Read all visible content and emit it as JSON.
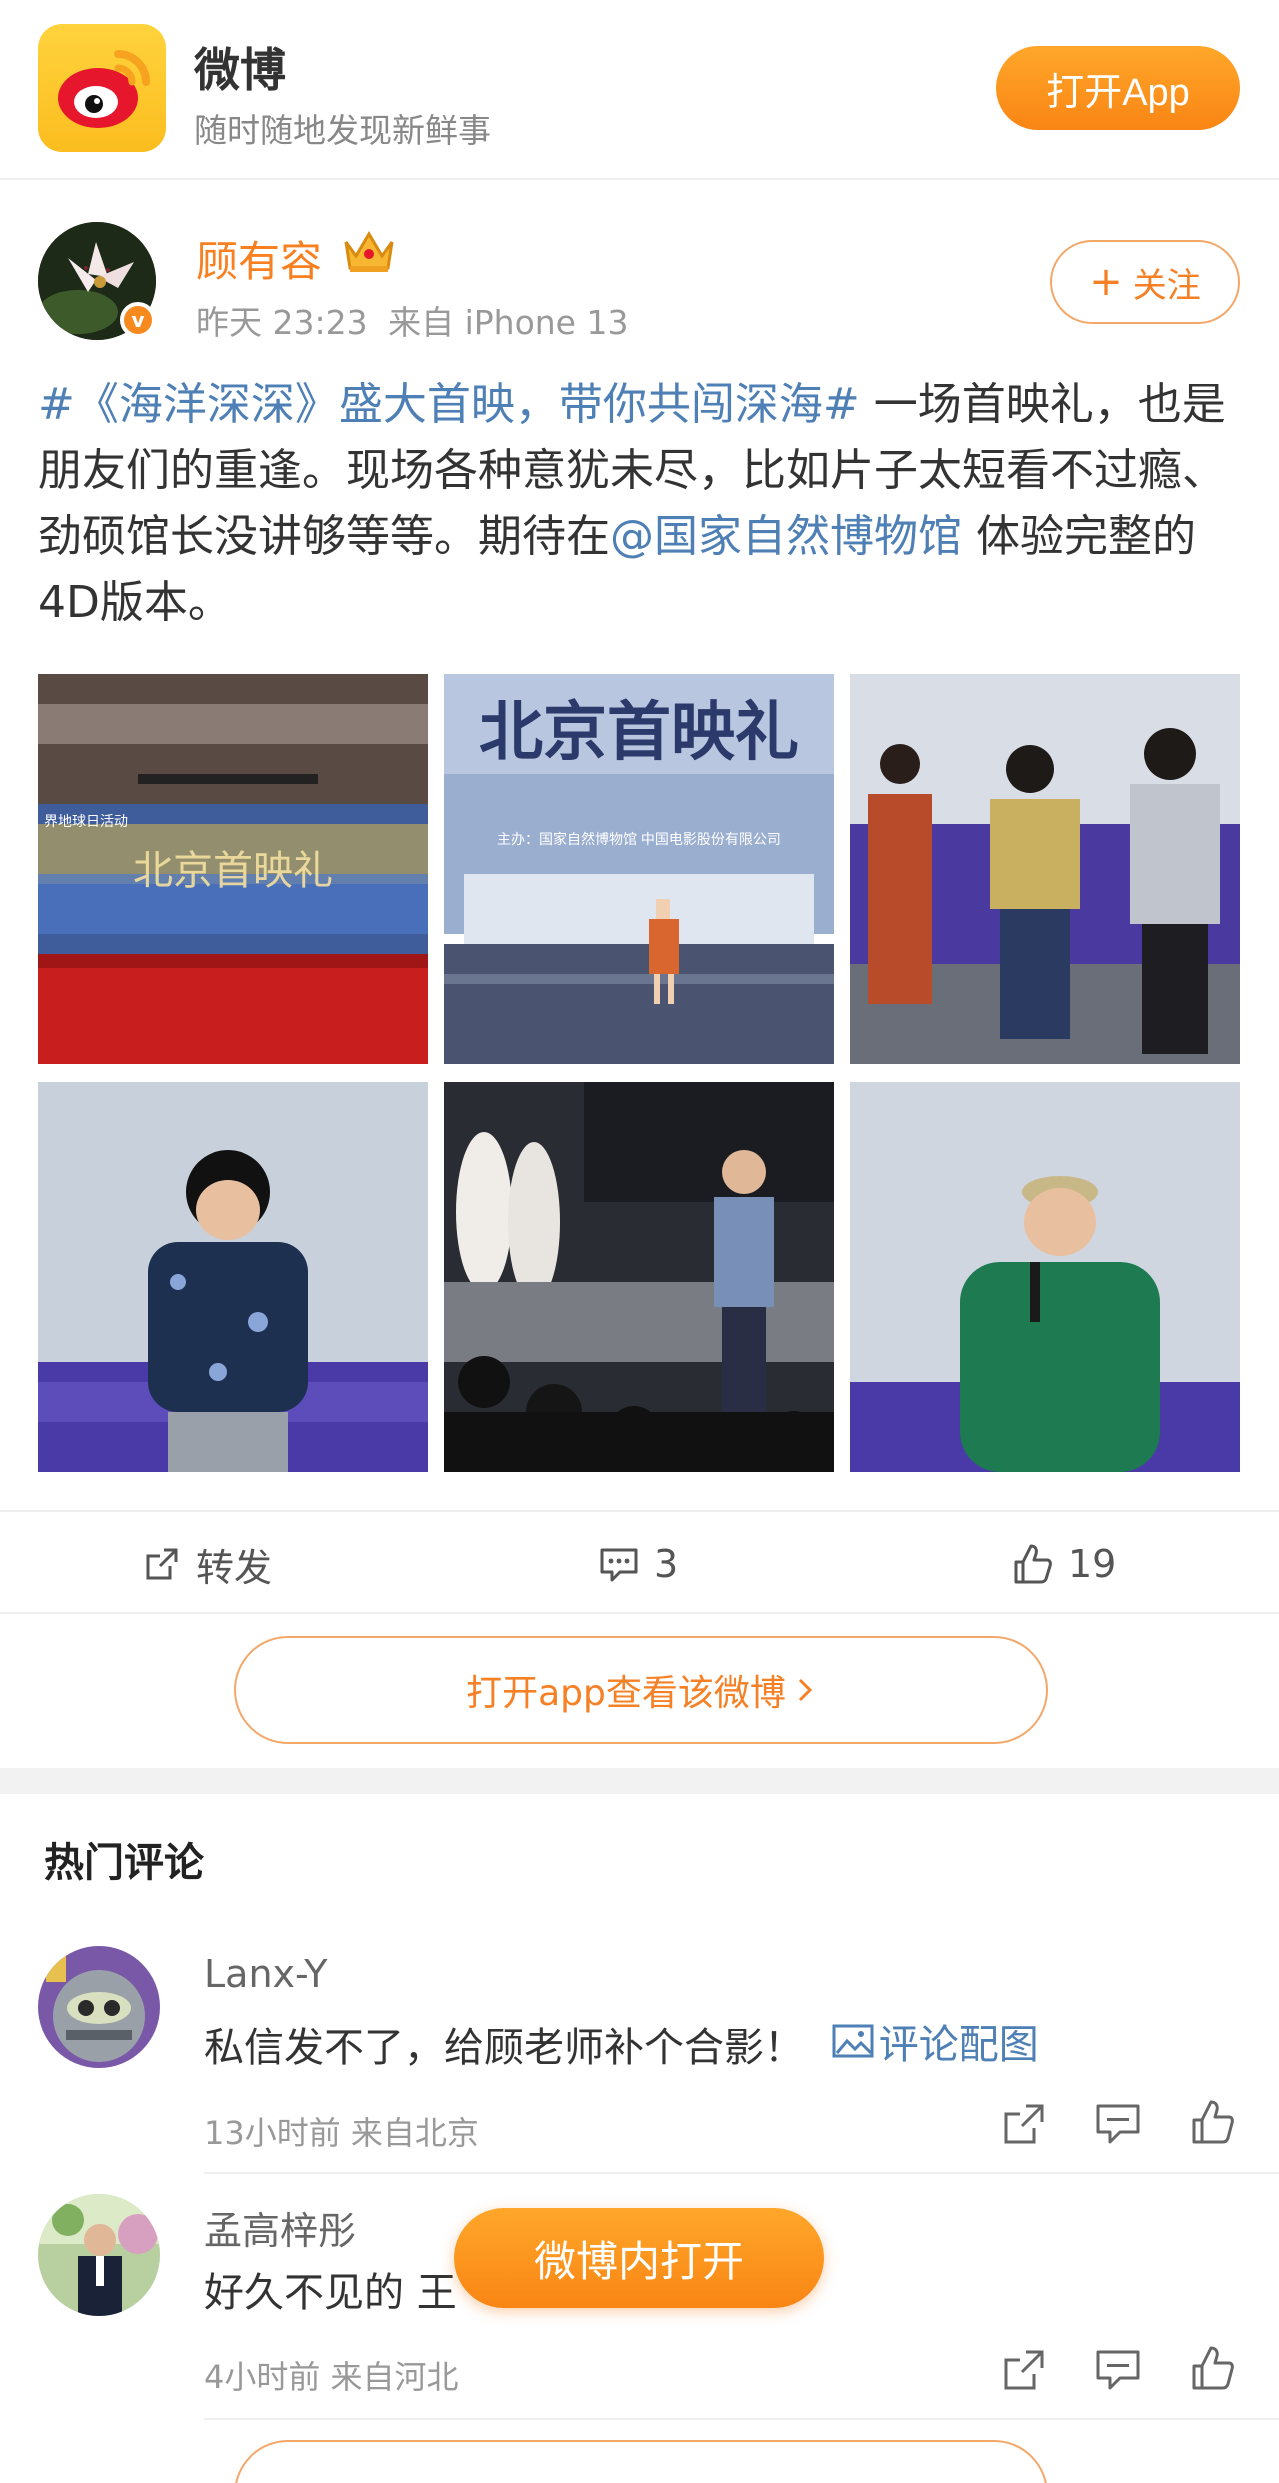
{
  "header": {
    "app_name": "微博",
    "tagline": "随时随地发现新鲜事",
    "open_app_label": "打开App"
  },
  "post": {
    "author": "顾有容",
    "time": "昨天 23:23",
    "source": "来自 iPhone 13",
    "follow_label": "关注",
    "text": {
      "hashtag": "#《海洋深深》盛大首映，带你共闯深海#",
      "body": " 一场首映礼，也是朋友们的重逢。现场各种意犹未尽，比如片子太短看不过瘾、劲硕馆长没讲够等等。期待在",
      "mention": "@国家自然博物馆",
      "tail": " 体验完整的4D版本。"
    },
    "images": [
      {
        "caption": "北京首映礼",
        "subtitle": "界地球日活动"
      },
      {
        "caption": "北京首映礼",
        "subtitle": "主办：国家自然博物馆  中国电影股份有限公司"
      },
      {
        "caption": ""
      },
      {
        "caption": ""
      },
      {
        "caption": ""
      },
      {
        "caption": ""
      }
    ],
    "actions": {
      "repost_label": "转发",
      "comment_count": "3",
      "like_count": "19"
    },
    "open_in_app_label": "打开app查看该微博"
  },
  "comments_section": {
    "title": "热门评论",
    "comments": [
      {
        "user": "Lanx-Y",
        "text": "私信发不了，给顾老师补个合影！",
        "image_link": "评论配图",
        "meta": "13小时前 来自北京"
      },
      {
        "user": "孟高梓彤",
        "text": "好久不见的 王",
        "meta": "4小时前 来自河北"
      }
    ]
  },
  "floating_open_label": "微博内打开",
  "colors": {
    "brand_orange": "#f98514",
    "link_blue": "#4e7fb5",
    "username_orange": "#f88020"
  }
}
